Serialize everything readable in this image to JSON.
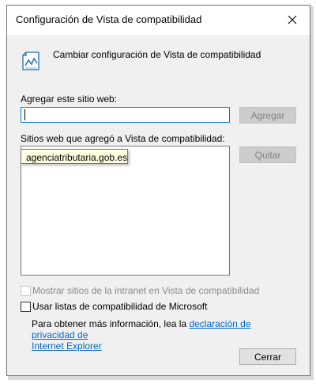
{
  "dialog": {
    "title": "Configuración de Vista de compatibilidad",
    "header_text": "Cambiar configuración de Vista de compatibilidad",
    "add_site_label": "Agregar este sitio web:",
    "add_site_value": "",
    "add_button": "Agregar",
    "list_label": "Sitios web que agregó a Vista de compatibilidad:",
    "sites": [
      "agenciatributaria.gob.es"
    ],
    "remove_button": "Quitar",
    "intranet_checkbox_label": "Mostrar sitios de la intranet en Vista de compatibilidad",
    "microsoft_lists_checkbox_label": "Usar listas de compatibilidad de Microsoft",
    "info_prefix": "Para obtener más información, lea la ",
    "privacy_link_part1": "declaración de privacidad de",
    "privacy_link_part2": "Internet Explorer",
    "close_button": "Cerrar"
  },
  "colors": {
    "dialog_background": "#f0f0f0",
    "focus_border": "#0078d7",
    "link": "#0066cc",
    "tooltip_background": "#ffffe1"
  },
  "icons": {
    "close": "close-icon",
    "header": "compatibility-view-icon"
  }
}
